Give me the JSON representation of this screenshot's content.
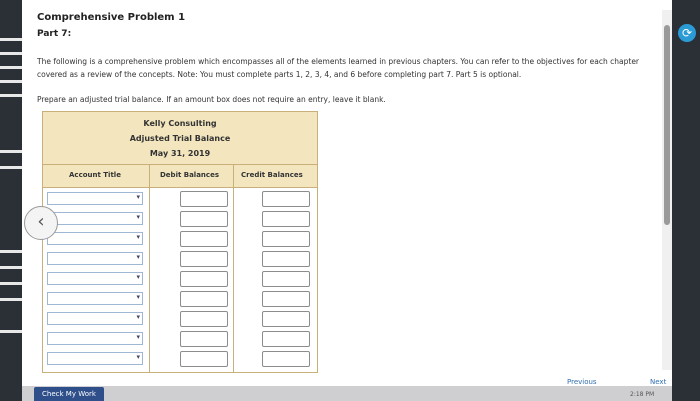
{
  "problem": {
    "title": "Comprehensive Problem 1",
    "part": "Part 7:",
    "description": "The following is a comprehensive problem which encompasses all of the elements learned in previous chapters. You can refer to the objectives for each chapter covered as a review of the concepts. Note: You must complete parts 1, 2, 3, 4, and 6 before completing part 7. Part 5 is optional.",
    "instruction": "Prepare an adjusted trial balance. If an amount box does not require an entry, leave it blank."
  },
  "trial_balance": {
    "company": "Kelly Consulting",
    "heading": "Adjusted Trial Balance",
    "date": "May 31, 2019",
    "columns": {
      "account": "Account Title",
      "debit": "Debit Balances",
      "credit": "Credit Balances"
    },
    "rows": [
      {
        "account": "",
        "debit": "",
        "credit": ""
      },
      {
        "account": "",
        "debit": "",
        "credit": ""
      },
      {
        "account": "",
        "debit": "",
        "credit": ""
      },
      {
        "account": "",
        "debit": "",
        "credit": ""
      },
      {
        "account": "",
        "debit": "",
        "credit": ""
      },
      {
        "account": "",
        "debit": "",
        "credit": ""
      },
      {
        "account": "",
        "debit": "",
        "credit": ""
      },
      {
        "account": "",
        "debit": "",
        "credit": ""
      },
      {
        "account": "",
        "debit": "",
        "credit": ""
      }
    ]
  },
  "footer": {
    "check_label": "Check My Work",
    "previous_label": "Previous",
    "next_label": "Next",
    "time": "2:18 PM"
  },
  "icons": {
    "back": "chevron-left-icon",
    "dropdown": "chevron-down-icon"
  }
}
